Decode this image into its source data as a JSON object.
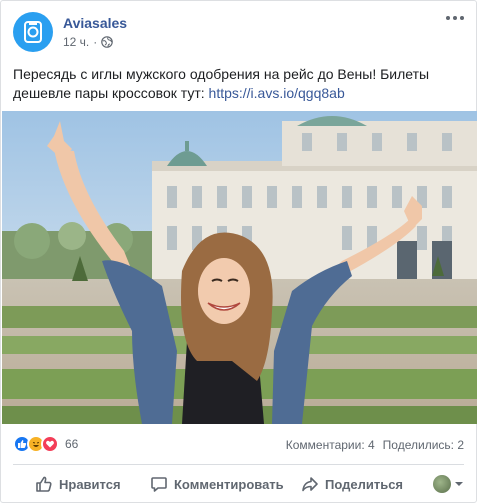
{
  "post": {
    "page_name": "Aviasales",
    "time": "12 ч.",
    "separator": "·",
    "text": "Пересядь с иглы мужского одобрения на рейс до Вены! Билеты дешевле пары кроссовок тут: ",
    "link": "https://i.avs.io/qgq8ab",
    "photo_icon": "photo-woman-arms-raised-belvedere-palace",
    "globe_icon": "globe-icon",
    "more_icon": "more-options-icon"
  },
  "stats": {
    "reactions": [
      "like",
      "haha",
      "love"
    ],
    "reaction_count": "66",
    "comments": "Комментарии: 4",
    "shares": "Поделились: 2"
  },
  "actions": {
    "like": "Нравится",
    "comment": "Комментировать",
    "share": "Поделиться"
  },
  "colors": {
    "page_name": "#385898",
    "like_blue": "#1877f2",
    "love_red": "#f33e58",
    "haha_yellow": "#f7b125",
    "brand": "#2a9ff0"
  }
}
